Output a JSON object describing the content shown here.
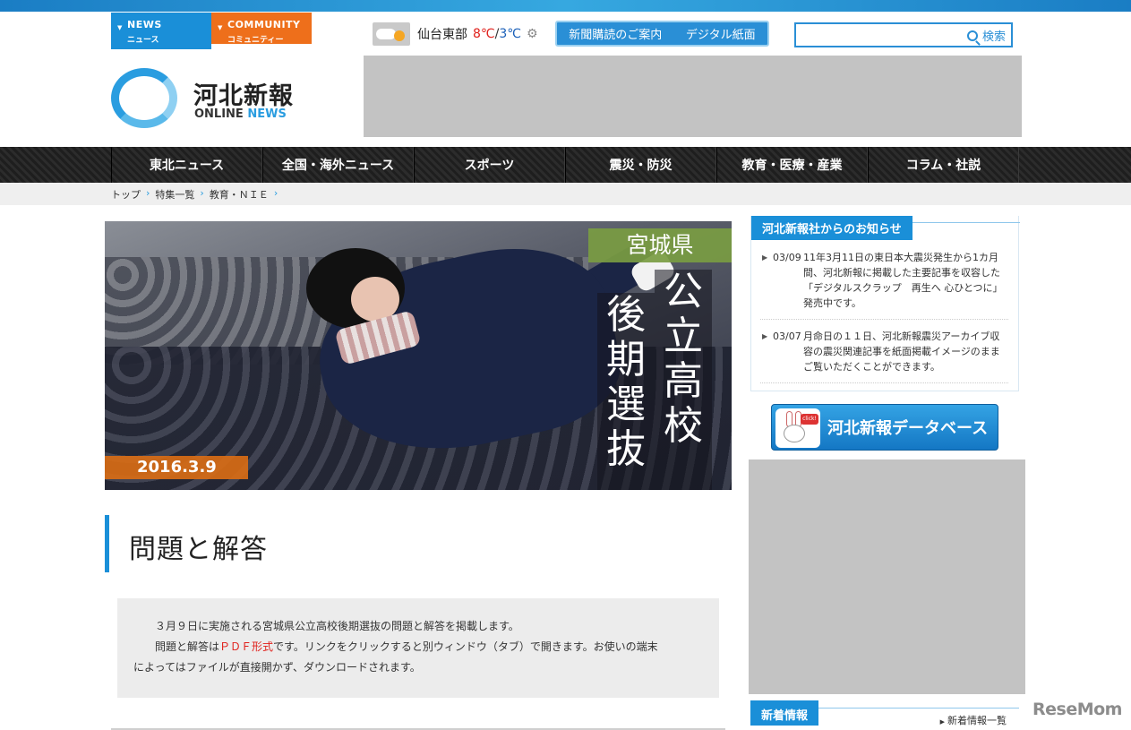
{
  "top_tabs": [
    {
      "en": "NEWS",
      "ja": "ニュース",
      "color": "#1a8fd8"
    },
    {
      "en": "COMMUNITY",
      "ja": "コミュニティー",
      "color": "#ee6f1b"
    }
  ],
  "weather": {
    "city": "仙台東部",
    "high": "8℃",
    "separator": "/",
    "low": "3℃",
    "icon": "partly-cloudy-icon"
  },
  "subscribe": {
    "item1": "新聞購読のご案内",
    "item2": "デジタル紙面"
  },
  "search": {
    "placeholder": "",
    "button_label": "検索"
  },
  "logo": {
    "ja": "河北新報",
    "en_prefix": "ONLINE",
    "en_suffix": "NEWS"
  },
  "global_nav": [
    "東北ニュース",
    "全国・海外ニュース",
    "スポーツ",
    "震災・防災",
    "教育・医療・産業",
    "コラム・社説"
  ],
  "breadcrumb": [
    "トップ",
    "特集一覧",
    "教育・ＮＩＥ"
  ],
  "breadcrumb_separator": "›",
  "hero": {
    "prefecture": "宮城県",
    "title_col1": "公立高校",
    "title_col2": "後期選抜",
    "date": "2016.3.9"
  },
  "page_title": "問題と解答",
  "notice": {
    "line1": "３月９日に実施される宮城県公立高校後期選抜の問題と解答を掲載します。",
    "line2_a": "問題と解答は",
    "line2_pdf": "ＰＤＦ形式",
    "line2_b": "です。リンクをクリックすると別ウィンドウ（タブ）で開きます。お使いの端末",
    "line3": "によってはファイルが直接開かず、ダウンロードされます。"
  },
  "sidebar": {
    "announcements_title": "河北新報社からのお知らせ",
    "announcements": [
      {
        "date": "03/09",
        "text": "11年3月11日の東日本大震災発生から1カ月間、河北新報に掲載した主要記事を収容した「デジタルスクラップ　再生へ 心ひとつに」発売中です。"
      },
      {
        "date": "03/07",
        "text": "月命日の１１日、河北新報震災アーカイブ収容の震災関連記事を紙面掲載イメージのままご覧いただくことができます。"
      }
    ],
    "database_banner": "河北新報データベース",
    "database_click": "click!",
    "new_info_title": "新着情報",
    "new_info_more": "新着情報一覧"
  },
  "watermark": "ReseMom",
  "colors": {
    "accent": "#1a8fd8",
    "orange": "#ee6f1b",
    "pdf_red": "#e0201b",
    "hero_pref": "#7a9c42"
  }
}
